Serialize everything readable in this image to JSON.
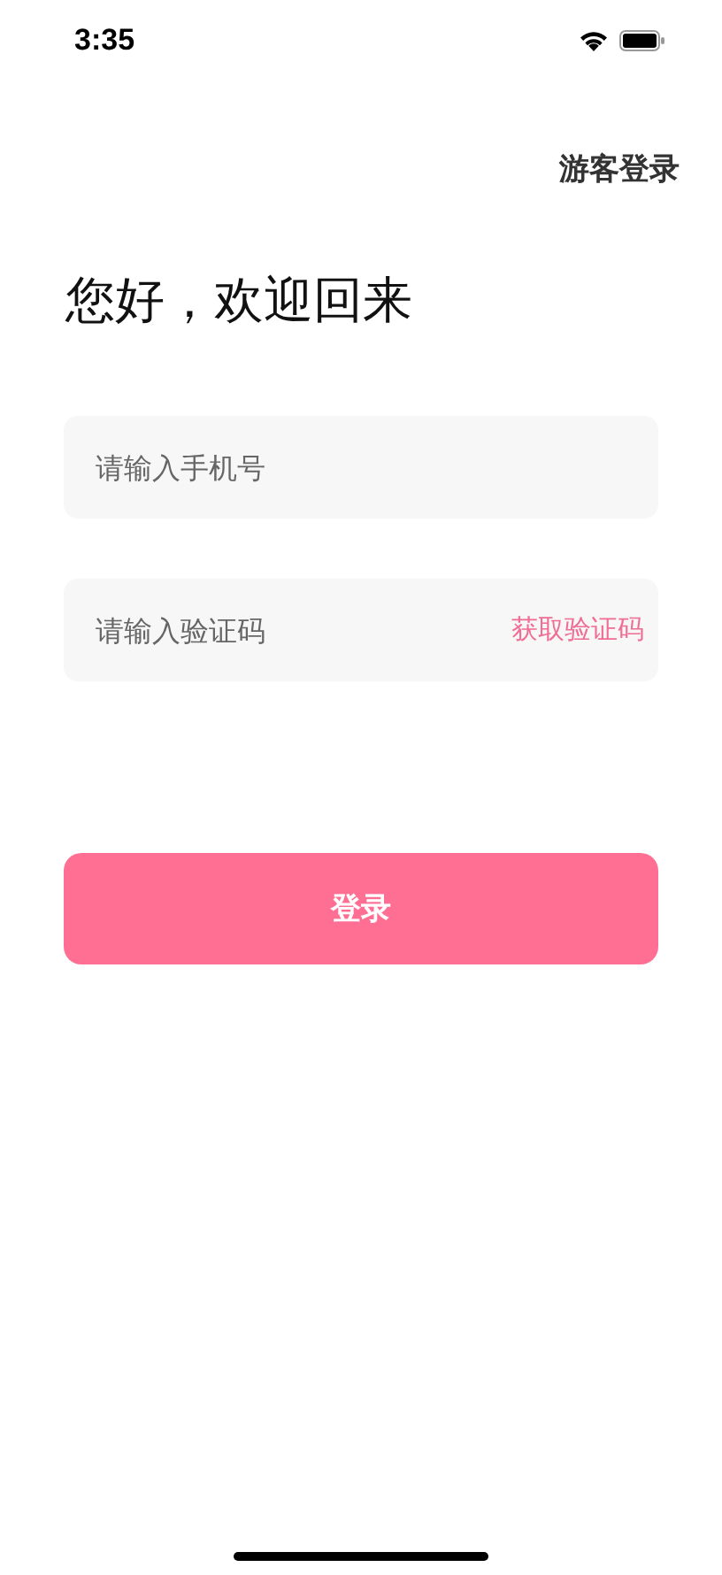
{
  "status_bar": {
    "time": "3:35"
  },
  "guest_login": "游客登录",
  "greeting": "您好，欢迎回来",
  "phone_field": {
    "placeholder": "请输入手机号"
  },
  "code_field": {
    "placeholder": "请输入验证码",
    "action": "获取验证码"
  },
  "login_button": "登录"
}
